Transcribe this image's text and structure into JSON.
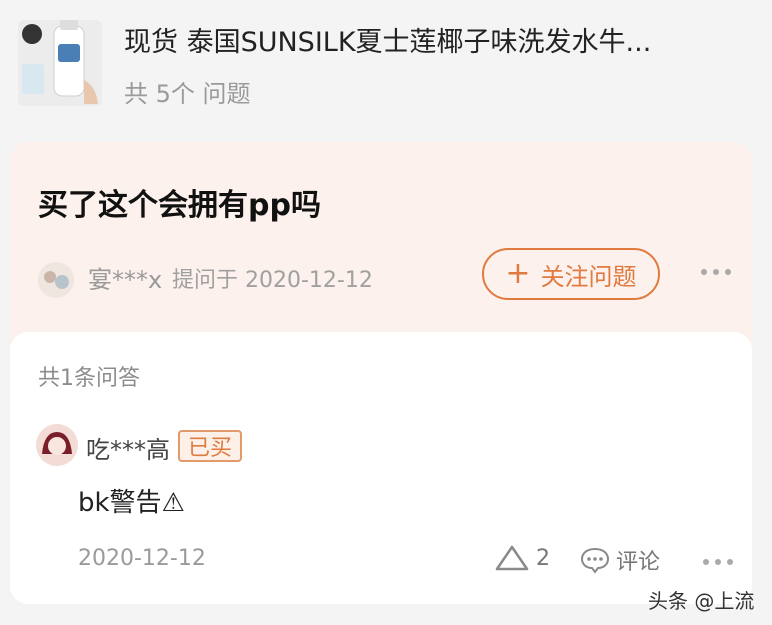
{
  "product": {
    "title": "现货 泰国SUNSILK夏士莲椰子味洗发水牛...",
    "question_count": "共 5个 问题",
    "image_icon": "product-thumbnail-icon"
  },
  "question": {
    "title": "买了这个会拥有pp吗",
    "user": "宴***x",
    "asked_on": "提问于 2020-12-12",
    "follow_label": "关注问题",
    "follow_icon": "plus-icon",
    "more_icon": "more-dots-icon"
  },
  "answers": {
    "count_label": "共1条问答",
    "items": [
      {
        "user": "吃***高",
        "badge": "已买",
        "content": "bk警告⚠",
        "date": "2020-12-12",
        "likes": "2",
        "comment_label": "评论"
      }
    ]
  },
  "watermark": "头条 @上流",
  "colors": {
    "accent": "#e07a3f",
    "question_bg": "#fcf1ec",
    "page_bg": "#f4f4f4"
  }
}
